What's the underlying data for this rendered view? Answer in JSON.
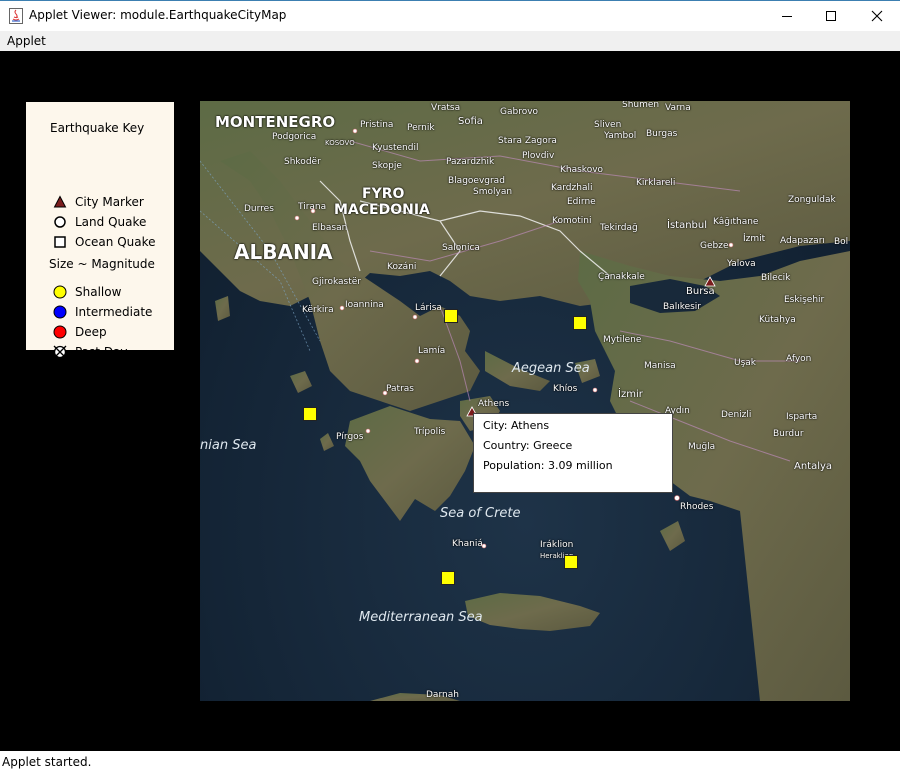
{
  "window": {
    "title": "Applet Viewer: module.EarthquakeCityMap"
  },
  "menu": {
    "applet_label": "Applet"
  },
  "status": {
    "text": "Applet started."
  },
  "key": {
    "title": "Earthquake Key",
    "items": [
      {
        "label": "City Marker"
      },
      {
        "label": "Land Quake"
      },
      {
        "label": "Ocean Quake"
      }
    ],
    "size_label": "Size ~ Magnitude",
    "depths": [
      {
        "label": "Shallow",
        "color": "#ffff00"
      },
      {
        "label": "Intermediate",
        "color": "#0000ff"
      },
      {
        "label": "Deep",
        "color": "#ff0000"
      },
      {
        "label": "Past Day"
      }
    ]
  },
  "map": {
    "countries": [
      "MONTENEGRO",
      "FYRO",
      "MACEDONIA",
      "ALBANIA"
    ],
    "seas": [
      "Aegean Sea",
      "nian Sea",
      "Sea of Crete",
      "Mediterranean Sea"
    ],
    "places": [
      "Vratsa",
      "Shumen",
      "Varna",
      "Podgorica",
      "Pristina",
      "Pernik",
      "Sofia",
      "Gabrovo",
      "Sliven",
      "Yambol",
      "Burgas",
      "KOSOVO",
      "Kyustendil",
      "Stara Zagora",
      "Shkodër",
      "Skopje",
      "Pazardzhik",
      "Plovdiv",
      "Khaskovo",
      "Kirklareli",
      "Blagoevgrad",
      "Smolyan",
      "Kardzhali",
      "Edirne",
      "Durres",
      "Tirana",
      "Elbasan",
      "Komotini",
      "Tekirdağ",
      "Zonguldak",
      "İstanbul",
      "Kâğıthane",
      "Gebze",
      "İzmit",
      "Adapazarı",
      "Bol",
      "Salonica",
      "Kozáni",
      "Yalova",
      "Bilecik",
      "Gjirokastër",
      "Çanakkale",
      "Bursa",
      "Eskişehir",
      "Kërkira",
      "Ioannina",
      "Lárisa",
      "Balıkesir",
      "Kütahya",
      "Mytilene",
      "Lamía",
      "Manisa",
      "Uşak",
      "Afyon",
      "Patras",
      "Khíos",
      "İzmir",
      "Athens",
      "Aydın",
      "Denizli",
      "Isparta",
      "Pírgos",
      "Trípolis",
      "Burdur",
      "Muğla",
      "Antalya",
      "Rhodes",
      "Khaniá",
      "Iráklion",
      "Heraklion",
      "Darnah"
    ]
  },
  "tooltip": {
    "city": "City: Athens",
    "country": "Country: Greece",
    "population": "Population: 3.09 million"
  }
}
